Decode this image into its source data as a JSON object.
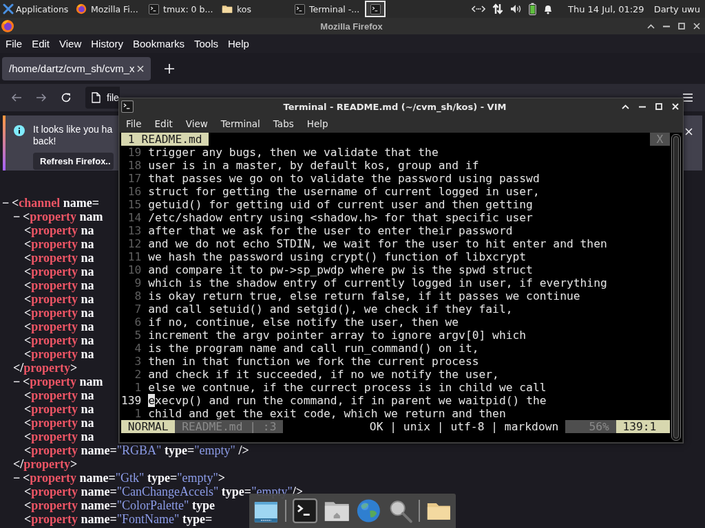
{
  "panel": {
    "apps_label": "Applications",
    "tasks": [
      {
        "kind": "browser",
        "label": "Mozilla Fi...",
        "selected": false
      },
      {
        "kind": "terminal",
        "label": "tmux: 0 b...",
        "selected": false
      },
      {
        "kind": "folder",
        "label": "kos",
        "selected": false
      },
      {
        "kind": "terminal",
        "label": "Terminal -...",
        "selected": false
      },
      {
        "kind": "terminal",
        "selected": true
      }
    ],
    "clock": "Thu 14 Jul, 01:29",
    "user": "Darty uwu"
  },
  "firefox": {
    "title": "Mozilla Firefox",
    "menu": [
      "File",
      "Edit",
      "View",
      "History",
      "Bookmarks",
      "Tools",
      "Help"
    ],
    "tab": {
      "label": "/home/dartz/cvm_sh/cvm_x",
      "selected": true
    },
    "url": "file",
    "notification": {
      "lines": [
        "It looks like you ha",
        "back!"
      ],
      "button": "Refresh Firefox.."
    },
    "xml": [
      {
        "segs": [
          {
            "kind": "toggle",
            "text": "−"
          },
          {
            "kind": "p",
            "text": "<"
          },
          {
            "kind": "tag",
            "text": "channel"
          },
          {
            "kind": "attr",
            "text": " name"
          },
          {
            "kind": "p",
            "text": "="
          }
        ],
        "children": [
          {
            "segs": [
              {
                "kind": "toggle",
                "text": "−"
              },
              {
                "kind": "p",
                "text": "<"
              },
              {
                "kind": "tag",
                "text": "property"
              },
              {
                "kind": "attr",
                "text": " nam"
              }
            ],
            "children": [
              {
                "segs": [
                  {
                    "kind": "p",
                    "text": "<"
                  },
                  {
                    "kind": "tag",
                    "text": "property"
                  },
                  {
                    "kind": "attr",
                    "text": " na"
                  }
                ]
              },
              {
                "segs": [
                  {
                    "kind": "p",
                    "text": "<"
                  },
                  {
                    "kind": "tag",
                    "text": "property"
                  },
                  {
                    "kind": "attr",
                    "text": " na"
                  }
                ]
              },
              {
                "segs": [
                  {
                    "kind": "p",
                    "text": "<"
                  },
                  {
                    "kind": "tag",
                    "text": "property"
                  },
                  {
                    "kind": "attr",
                    "text": " na"
                  }
                ]
              },
              {
                "segs": [
                  {
                    "kind": "p",
                    "text": "<"
                  },
                  {
                    "kind": "tag",
                    "text": "property"
                  },
                  {
                    "kind": "attr",
                    "text": " na"
                  }
                ]
              },
              {
                "segs": [
                  {
                    "kind": "p",
                    "text": "<"
                  },
                  {
                    "kind": "tag",
                    "text": "property"
                  },
                  {
                    "kind": "attr",
                    "text": " na"
                  }
                ]
              },
              {
                "segs": [
                  {
                    "kind": "p",
                    "text": "<"
                  },
                  {
                    "kind": "tag",
                    "text": "property"
                  },
                  {
                    "kind": "attr",
                    "text": " na"
                  }
                ]
              },
              {
                "segs": [
                  {
                    "kind": "p",
                    "text": "<"
                  },
                  {
                    "kind": "tag",
                    "text": "property"
                  },
                  {
                    "kind": "attr",
                    "text": " na"
                  }
                ]
              },
              {
                "segs": [
                  {
                    "kind": "p",
                    "text": "<"
                  },
                  {
                    "kind": "tag",
                    "text": "property"
                  },
                  {
                    "kind": "attr",
                    "text": " na"
                  }
                ]
              },
              {
                "segs": [
                  {
                    "kind": "p",
                    "text": "<"
                  },
                  {
                    "kind": "tag",
                    "text": "property"
                  },
                  {
                    "kind": "attr",
                    "text": " na"
                  }
                ]
              },
              {
                "segs": [
                  {
                    "kind": "p",
                    "text": "<"
                  },
                  {
                    "kind": "tag",
                    "text": "property"
                  },
                  {
                    "kind": "attr",
                    "text": " na"
                  }
                ]
              }
            ],
            "close": [
              {
                "kind": "p",
                "text": "</"
              },
              {
                "kind": "tag",
                "text": "property"
              },
              {
                "kind": "p",
                "text": ">"
              }
            ]
          },
          {
            "segs": [
              {
                "kind": "toggle",
                "text": "−"
              },
              {
                "kind": "p",
                "text": "<"
              },
              {
                "kind": "tag",
                "text": "property"
              },
              {
                "kind": "attr",
                "text": " nam"
              }
            ],
            "children": [
              {
                "segs": [
                  {
                    "kind": "p",
                    "text": "<"
                  },
                  {
                    "kind": "tag",
                    "text": "property"
                  },
                  {
                    "kind": "attr",
                    "text": " na"
                  }
                ]
              },
              {
                "segs": [
                  {
                    "kind": "p",
                    "text": "<"
                  },
                  {
                    "kind": "tag",
                    "text": "property"
                  },
                  {
                    "kind": "attr",
                    "text": " na"
                  }
                ]
              },
              {
                "segs": [
                  {
                    "kind": "p",
                    "text": "<"
                  },
                  {
                    "kind": "tag",
                    "text": "property"
                  },
                  {
                    "kind": "attr",
                    "text": " na"
                  }
                ]
              },
              {
                "segs": [
                  {
                    "kind": "p",
                    "text": "<"
                  },
                  {
                    "kind": "tag",
                    "text": "property"
                  },
                  {
                    "kind": "attr",
                    "text": " na"
                  }
                ]
              },
              {
                "segs": [
                  {
                    "kind": "p",
                    "text": "<"
                  },
                  {
                    "kind": "tag",
                    "text": "property"
                  },
                  {
                    "kind": "attr",
                    "text": " name"
                  },
                  {
                    "kind": "p",
                    "text": "="
                  },
                  {
                    "kind": "val",
                    "text": "\"RGBA\""
                  },
                  {
                    "kind": "attr",
                    "text": " type"
                  },
                  {
                    "kind": "p",
                    "text": "="
                  },
                  {
                    "kind": "val",
                    "text": "\"empty\""
                  },
                  {
                    "kind": "p",
                    "text": " />"
                  }
                ]
              }
            ],
            "close": [
              {
                "kind": "p",
                "text": "</"
              },
              {
                "kind": "tag",
                "text": "property"
              },
              {
                "kind": "p",
                "text": ">"
              }
            ]
          },
          {
            "segs": [
              {
                "kind": "toggle",
                "text": "−"
              },
              {
                "kind": "p",
                "text": "<"
              },
              {
                "kind": "tag",
                "text": "property"
              },
              {
                "kind": "attr",
                "text": " name"
              },
              {
                "kind": "p",
                "text": "="
              },
              {
                "kind": "val",
                "text": "\"Gtk\""
              },
              {
                "kind": "attr",
                "text": " type"
              },
              {
                "kind": "p",
                "text": "="
              },
              {
                "kind": "val",
                "text": "\"empty\""
              },
              {
                "kind": "p",
                "text": ">"
              }
            ],
            "children": [
              {
                "segs": [
                  {
                    "kind": "p",
                    "text": "<"
                  },
                  {
                    "kind": "tag",
                    "text": "property"
                  },
                  {
                    "kind": "attr",
                    "text": " name"
                  },
                  {
                    "kind": "p",
                    "text": "="
                  },
                  {
                    "kind": "val",
                    "text": "\"CanChangeAccels\""
                  },
                  {
                    "kind": "attr",
                    "text": " type"
                  },
                  {
                    "kind": "p",
                    "text": "="
                  },
                  {
                    "kind": "val",
                    "text": "\"empty\""
                  },
                  {
                    "kind": "p",
                    "text": "/>"
                  }
                ]
              },
              {
                "segs": [
                  {
                    "kind": "p",
                    "text": "<"
                  },
                  {
                    "kind": "tag",
                    "text": "property"
                  },
                  {
                    "kind": "attr",
                    "text": " name"
                  },
                  {
                    "kind": "p",
                    "text": "="
                  },
                  {
                    "kind": "val",
                    "text": "\"ColorPalette\""
                  },
                  {
                    "kind": "attr",
                    "text": " type"
                  }
                ]
              },
              {
                "segs": [
                  {
                    "kind": "p",
                    "text": "<"
                  },
                  {
                    "kind": "tag",
                    "text": "property"
                  },
                  {
                    "kind": "attr",
                    "text": " name"
                  },
                  {
                    "kind": "p",
                    "text": "="
                  },
                  {
                    "kind": "val",
                    "text": "\"FontName\""
                  },
                  {
                    "kind": "attr",
                    "text": " type"
                  },
                  {
                    "kind": "p",
                    "text": "="
                  }
                ]
              }
            ]
          }
        ]
      }
    ]
  },
  "terminal": {
    "title": "Terminal - README.md (~/cvm_sh/kos) - VIM",
    "menu": [
      "File",
      "Edit",
      "View",
      "Terminal",
      "Tabs",
      "Help"
    ],
    "vim": {
      "tabs": [
        {
          "label": "1 README.md",
          "selected": true
        }
      ],
      "close": "X",
      "lines": [
        {
          "num": "19",
          "text": "trigger any bugs, then we validate that the",
          "current": false
        },
        {
          "num": "18",
          "text": "user is in a master, by default kos, group and if",
          "current": false
        },
        {
          "num": "17",
          "text": "that passes we go on to validate the password using passwd",
          "current": false
        },
        {
          "num": "16",
          "text": "struct for getting the username of current logged in user,",
          "current": false
        },
        {
          "num": "15",
          "text": "getuid() for getting uid of current user and then getting",
          "current": false
        },
        {
          "num": "14",
          "text": "/etc/shadow entry using <shadow.h> for that specific user",
          "current": false
        },
        {
          "num": "13",
          "text": "after that we ask for the user to enter their password",
          "current": false
        },
        {
          "num": "12",
          "text": "and we do not echo STDIN, we wait for the user to hit enter and then",
          "current": false
        },
        {
          "num": "11",
          "text": "we hash the password using crypt() function of libxcrypt",
          "current": false
        },
        {
          "num": "10",
          "text": "and compare it to pw->sp_pwdp where pw is the spwd struct",
          "current": false
        },
        {
          "num": "9",
          "text": "which is the shadow entry of currently logged in user, if everything",
          "current": false
        },
        {
          "num": "8",
          "text": "is okay return true, else return false, if it passes we continue",
          "current": false
        },
        {
          "num": "7",
          "text": "and call setuid() and setgid(), we check if they fail,",
          "current": false
        },
        {
          "num": "6",
          "text": "if no, continue, else notify the user, then we",
          "current": false
        },
        {
          "num": "5",
          "text": "increment the argv pointer array to ignore argv[0] which",
          "current": false
        },
        {
          "num": "4",
          "text": "is the program name and call run_command() on it,",
          "current": false
        },
        {
          "num": "3",
          "text": "then in that function we fork the current process",
          "current": false
        },
        {
          "num": "2",
          "text": "and check if it succeeded, if no we notify the user,",
          "current": false
        },
        {
          "num": "1",
          "text": "else we contnue, if the currect process is in child we call",
          "current": false
        },
        {
          "num": "139",
          "text": "execvp() and run the command, if in parent we waitpid() the",
          "current": true
        },
        {
          "num": "1",
          "text": "child and get the exit code, which we return and then",
          "current": false
        }
      ],
      "status": [
        {
          "kind": "mode",
          "text": "NORMAL"
        },
        {
          "kind": "file",
          "text": "README.md | :3"
        },
        {
          "kind": "info",
          "text": "OK | unix | utf-8 | markdown"
        },
        {
          "kind": "percent",
          "text": "56%"
        },
        {
          "kind": "position",
          "text": "139:1"
        }
      ]
    }
  }
}
